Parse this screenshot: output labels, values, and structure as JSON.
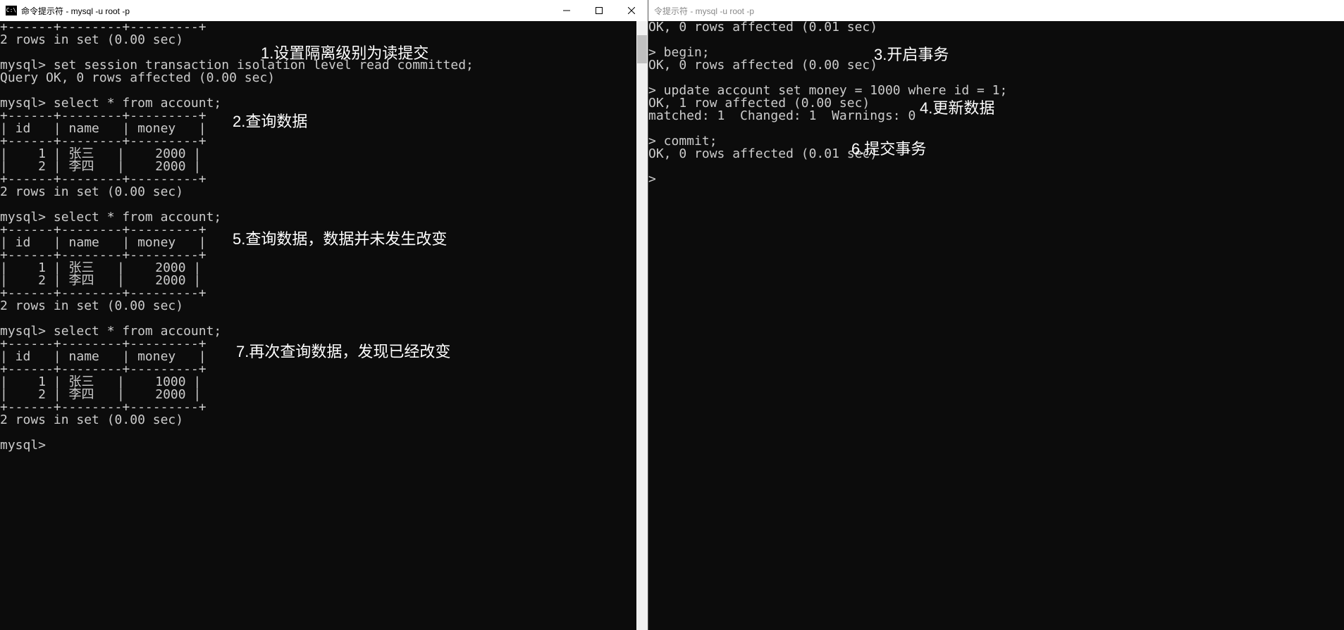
{
  "leftWindow": {
    "title": "命令提示符 - mysql  -u root -p",
    "lines": [
      "+------+--------+---------+",
      "2 rows in set (0.00 sec)",
      "",
      "mysql> set session transaction isolation level read committed;",
      "Query OK, 0 rows affected (0.00 sec)",
      "",
      "mysql> select * from account;",
      "+------+--------+---------+",
      "| id   | name   | money   |",
      "+------+--------+---------+",
      "|    1 | 张三   |    2000 |",
      "|    2 | 李四   |    2000 |",
      "+------+--------+---------+",
      "2 rows in set (0.00 sec)",
      "",
      "mysql> select * from account;",
      "+------+--------+---------+",
      "| id   | name   | money   |",
      "+------+--------+---------+",
      "|    1 | 张三   |    2000 |",
      "|    2 | 李四   |    2000 |",
      "+------+--------+---------+",
      "2 rows in set (0.00 sec)",
      "",
      "mysql> select * from account;",
      "+------+--------+---------+",
      "| id   | name   | money   |",
      "+------+--------+---------+",
      "|    1 | 张三   |    1000 |",
      "|    2 | 李四   |    2000 |",
      "+------+--------+---------+",
      "2 rows in set (0.00 sec)",
      "",
      "mysql>"
    ]
  },
  "rightWindow": {
    "title": "令提示符 - mysql  -u root -p",
    "lines": [
      "OK, 0 rows affected (0.01 sec)",
      "",
      "> begin;",
      "OK, 0 rows affected (0.00 sec)",
      "",
      "> update account set money = 1000 where id = 1;",
      "OK, 1 row affected (0.00 sec)",
      "matched: 1  Changed: 1  Warnings: 0",
      "",
      "> commit;",
      "OK, 0 rows affected (0.01 sec)",
      "",
      ">"
    ]
  },
  "annotations": {
    "a1": "1.设置隔离级别为读提交",
    "a2": "2.查询数据",
    "a3": "3.开启事务",
    "a4": "4.更新数据",
    "a5": "5.查询数据，数据并未发生改变",
    "a6": "6.提交事务",
    "a7": "7.再次查询数据，发现已经改变"
  },
  "iconText": "C:\\"
}
